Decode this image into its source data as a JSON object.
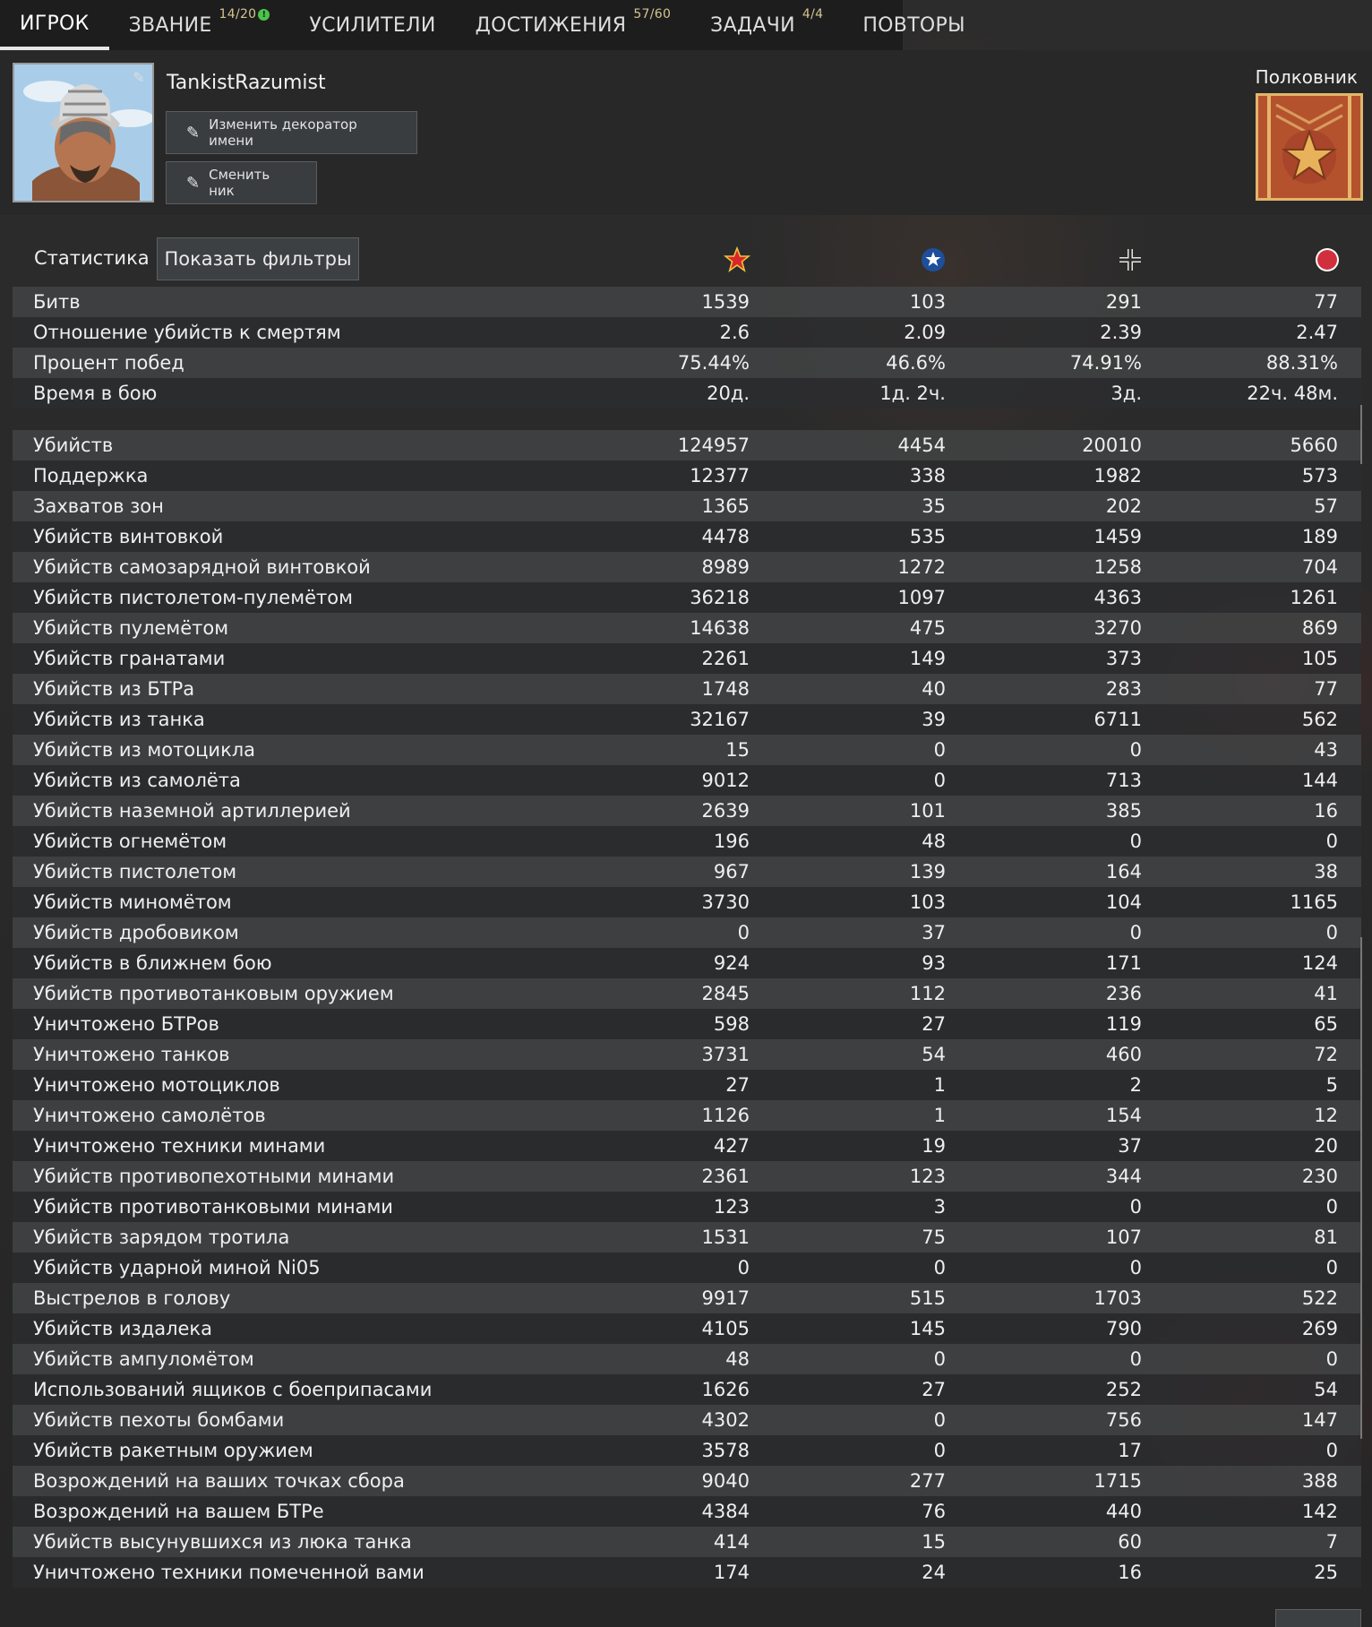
{
  "tabs": [
    {
      "label": "ИГРОК",
      "badge": ""
    },
    {
      "label": "ЗВАНИЕ",
      "badge": "14/20"
    },
    {
      "label": "УСИЛИТЕЛИ",
      "badge": ""
    },
    {
      "label": "ДОСТИЖЕНИЯ",
      "badge": "57/60"
    },
    {
      "label": "ЗАДАЧИ",
      "badge": "4/4"
    },
    {
      "label": "ПОВТОРЫ",
      "badge": ""
    }
  ],
  "player": {
    "name": "TankistRazumist",
    "change_decorator_label": "Изменить декоратор имени",
    "change_nick_label": "Сменить ник",
    "rank": "Полковник"
  },
  "stats": {
    "title": "Статистика",
    "filters_label": "Показать фильтры",
    "factions": [
      "ussr-star-icon",
      "usa-star-icon",
      "germany-cross-icon",
      "japan-sun-icon"
    ],
    "summary": [
      {
        "name": "Битв",
        "values": [
          "1539",
          "103",
          "291",
          "77"
        ]
      },
      {
        "name": "Отношение убийств к смертям",
        "values": [
          "2.6",
          "2.09",
          "2.39",
          "2.47"
        ]
      },
      {
        "name": "Процент побед",
        "values": [
          "75.44%",
          "46.6%",
          "74.91%",
          "88.31%"
        ]
      },
      {
        "name": "Время в бою",
        "values": [
          "20д.",
          "1д. 2ч.",
          "3д.",
          "22ч. 48м."
        ]
      }
    ],
    "details": [
      {
        "name": "Убийств",
        "values": [
          "124957",
          "4454",
          "20010",
          "5660"
        ]
      },
      {
        "name": "Поддержка",
        "values": [
          "12377",
          "338",
          "1982",
          "573"
        ]
      },
      {
        "name": "Захватов зон",
        "values": [
          "1365",
          "35",
          "202",
          "57"
        ]
      },
      {
        "name": "Убийств винтовкой",
        "values": [
          "4478",
          "535",
          "1459",
          "189"
        ]
      },
      {
        "name": "Убийств самозарядной винтовкой",
        "values": [
          "8989",
          "1272",
          "1258",
          "704"
        ]
      },
      {
        "name": "Убийств пистолетом-пулемётом",
        "values": [
          "36218",
          "1097",
          "4363",
          "1261"
        ]
      },
      {
        "name": "Убийств пулемётом",
        "values": [
          "14638",
          "475",
          "3270",
          "869"
        ]
      },
      {
        "name": "Убийств гранатами",
        "values": [
          "2261",
          "149",
          "373",
          "105"
        ]
      },
      {
        "name": "Убийств из БТРа",
        "values": [
          "1748",
          "40",
          "283",
          "77"
        ]
      },
      {
        "name": "Убийств из танка",
        "values": [
          "32167",
          "39",
          "6711",
          "562"
        ]
      },
      {
        "name": "Убийств из мотоцикла",
        "values": [
          "15",
          "0",
          "0",
          "43"
        ]
      },
      {
        "name": "Убийств из самолёта",
        "values": [
          "9012",
          "0",
          "713",
          "144"
        ]
      },
      {
        "name": "Убийств наземной артиллерией",
        "values": [
          "2639",
          "101",
          "385",
          "16"
        ]
      },
      {
        "name": "Убийств огнемётом",
        "values": [
          "196",
          "48",
          "0",
          "0"
        ]
      },
      {
        "name": "Убийств пистолетом",
        "values": [
          "967",
          "139",
          "164",
          "38"
        ]
      },
      {
        "name": "Убийств миномётом",
        "values": [
          "3730",
          "103",
          "104",
          "1165"
        ]
      },
      {
        "name": "Убийств дробовиком",
        "values": [
          "0",
          "37",
          "0",
          "0"
        ]
      },
      {
        "name": "Убийств в ближнем бою",
        "values": [
          "924",
          "93",
          "171",
          "124"
        ]
      },
      {
        "name": "Убийств противотанковым оружием",
        "values": [
          "2845",
          "112",
          "236",
          "41"
        ]
      },
      {
        "name": "Уничтожено БТРов",
        "values": [
          "598",
          "27",
          "119",
          "65"
        ]
      },
      {
        "name": "Уничтожено танков",
        "values": [
          "3731",
          "54",
          "460",
          "72"
        ]
      },
      {
        "name": "Уничтожено мотоциклов",
        "values": [
          "27",
          "1",
          "2",
          "5"
        ]
      },
      {
        "name": "Уничтожено самолётов",
        "values": [
          "1126",
          "1",
          "154",
          "12"
        ]
      },
      {
        "name": "Уничтожено техники минами",
        "values": [
          "427",
          "19",
          "37",
          "20"
        ]
      },
      {
        "name": "Убийств противопехотными минами",
        "values": [
          "2361",
          "123",
          "344",
          "230"
        ]
      },
      {
        "name": "Убийств противотанковыми минами",
        "values": [
          "123",
          "3",
          "0",
          "0"
        ]
      },
      {
        "name": "Убийств зарядом тротила",
        "values": [
          "1531",
          "75",
          "107",
          "81"
        ]
      },
      {
        "name": "Убийств ударной миной Ni05",
        "values": [
          "0",
          "0",
          "0",
          "0"
        ]
      },
      {
        "name": "Выстрелов в голову",
        "values": [
          "9917",
          "515",
          "1703",
          "522"
        ]
      },
      {
        "name": "Убийств издалека",
        "values": [
          "4105",
          "145",
          "790",
          "269"
        ]
      },
      {
        "name": "Убийств ампуломётом",
        "values": [
          "48",
          "0",
          "0",
          "0"
        ]
      },
      {
        "name": "Использований ящиков с боеприпасами",
        "values": [
          "1626",
          "27",
          "252",
          "54"
        ]
      },
      {
        "name": "Убийств пехоты бомбами",
        "values": [
          "4302",
          "0",
          "756",
          "147"
        ]
      },
      {
        "name": "Убийств ракетным оружием",
        "values": [
          "3578",
          "0",
          "17",
          "0"
        ]
      },
      {
        "name": "Возрождений на ваших точках сбора",
        "values": [
          "9040",
          "277",
          "1715",
          "388"
        ]
      },
      {
        "name": "Возрождений на вашем БТРе",
        "values": [
          "4384",
          "76",
          "440",
          "142"
        ]
      },
      {
        "name": "Убийств высунувшихся из люка танка",
        "values": [
          "414",
          "15",
          "60",
          "7"
        ]
      },
      {
        "name": "Уничтожено техники помеченной вами",
        "values": [
          "174",
          "24",
          "16",
          "25"
        ]
      }
    ]
  },
  "colors": {
    "ussr": "#d12b2b",
    "usa": "#1f4f9a",
    "japan": "#d32f3f",
    "rank_border": "#e3b56b"
  }
}
